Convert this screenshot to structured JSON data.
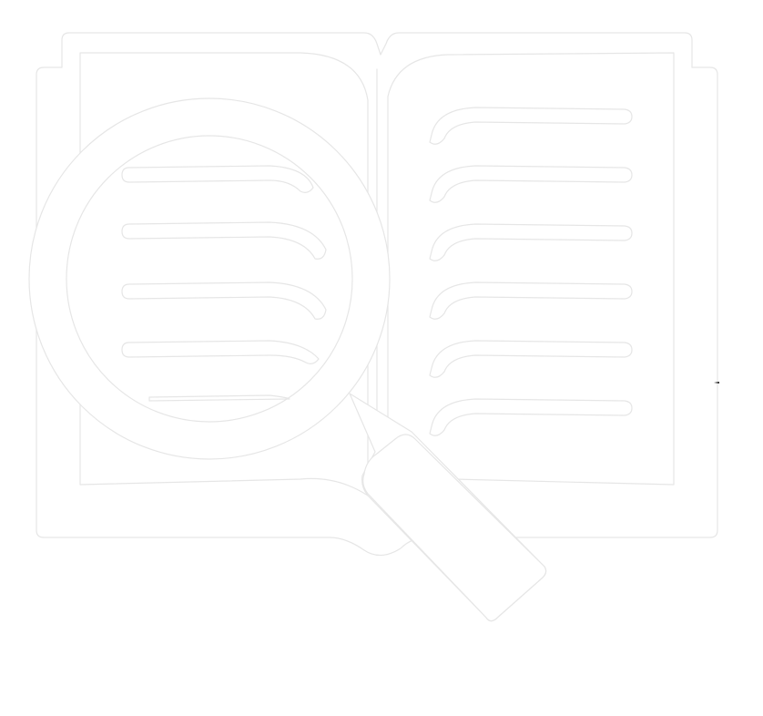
{
  "colors": {
    "background": "#ffffff",
    "fill": "#ffffff",
    "outline": "#e6e6e6"
  },
  "icon": "book-search-icon"
}
